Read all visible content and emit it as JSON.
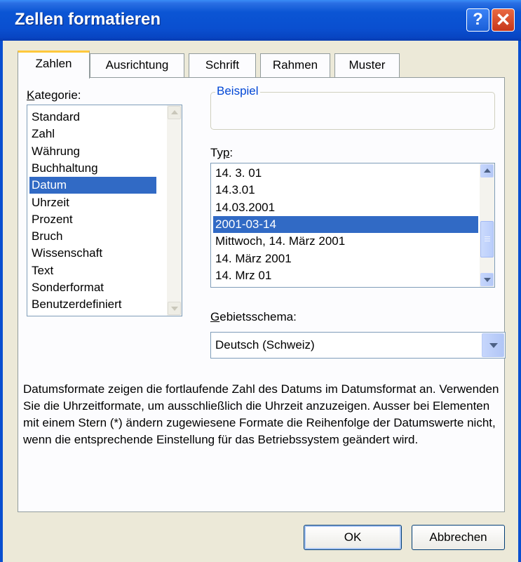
{
  "window": {
    "title": "Zellen formatieren",
    "help_glyph": "?",
    "close_glyph": "✕"
  },
  "tabs": [
    {
      "label": "Zahlen"
    },
    {
      "label": "Ausrichtung"
    },
    {
      "label": "Schrift"
    },
    {
      "label": "Rahmen"
    },
    {
      "label": "Muster"
    }
  ],
  "kategorie": {
    "label_key": "K",
    "label_rest": "ategorie:",
    "items": [
      "Standard",
      "Zahl",
      "Währung",
      "Buchhaltung",
      "Datum",
      "Uhrzeit",
      "Prozent",
      "Bruch",
      "Wissenschaft",
      "Text",
      "Sonderformat",
      "Benutzerdefiniert"
    ],
    "selected": "Datum"
  },
  "beispiel": {
    "label": "Beispiel",
    "value": ""
  },
  "typ": {
    "label_pre": "Ty",
    "label_key": "p",
    "label_post": ":",
    "items": [
      "14. 3. 01",
      "14.3.01",
      "14.03.2001",
      "2001-03-14",
      "Mittwoch, 14. März 2001",
      "14. März 2001",
      "14. Mrz 01"
    ],
    "selected": "2001-03-14"
  },
  "gebietsschema": {
    "label_key": "G",
    "label_rest": "ebietsschema:",
    "value": "Deutsch (Schweiz)"
  },
  "description": "Datumsformate zeigen die fortlaufende Zahl des Datums im Datumsformat an. Verwenden Sie die Uhrzeitformate, um ausschließlich die Uhrzeit anzuzeigen. Ausser bei Elementen mit einem Stern (*) ändern zugewiesene Formate die Reihenfolge der Datumswerte nicht, wenn die entsprechende Einstellung für das Betriebssystem geändert wird.",
  "buttons": {
    "ok": "OK",
    "cancel": "Abbrechen"
  },
  "colors": {
    "selection": "#316ac5",
    "titlebar": "#0a4fd0",
    "group_label": "#0046d5",
    "face": "#ece9d8"
  },
  "icons": {
    "help": "help-icon",
    "close": "close-icon",
    "scroll_up": "chevron-up-icon",
    "scroll_down": "chevron-down-icon",
    "combo": "chevron-down-icon"
  }
}
